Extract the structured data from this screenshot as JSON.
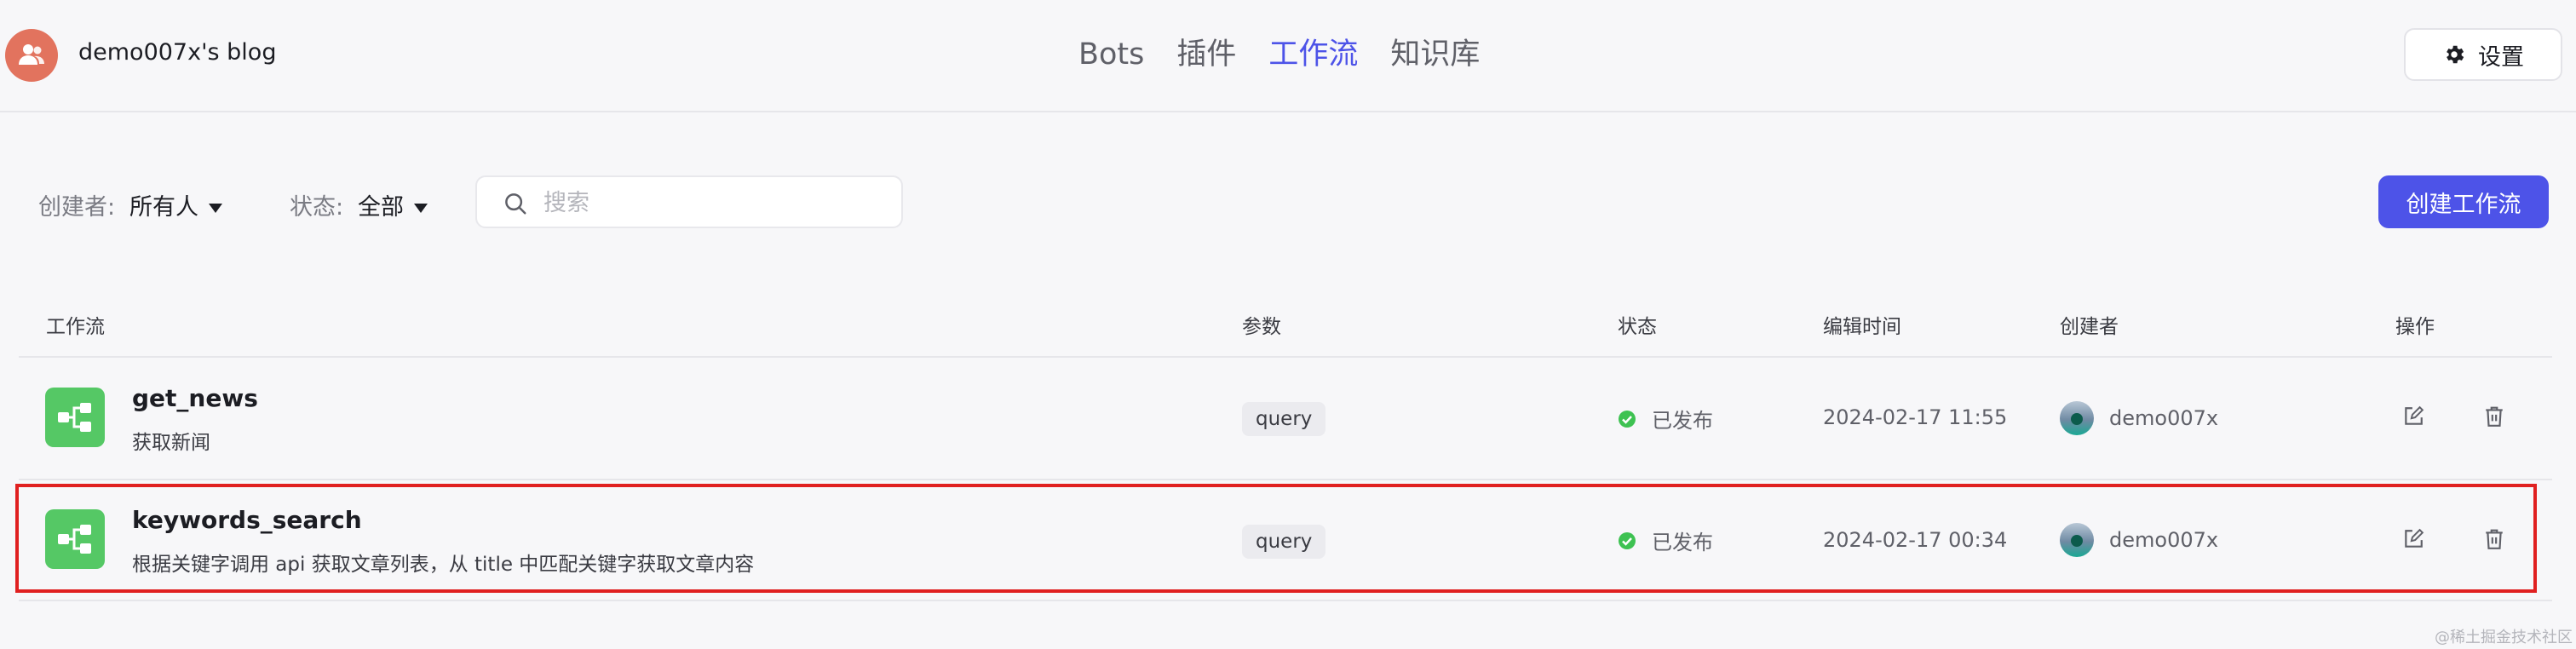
{
  "header": {
    "blog_title": "demo007x's blog",
    "nav": [
      {
        "label": "Bots",
        "active": false
      },
      {
        "label": "插件",
        "active": false
      },
      {
        "label": "工作流",
        "active": true
      },
      {
        "label": "知识库",
        "active": false
      }
    ],
    "settings_label": "设置"
  },
  "filters": {
    "creator_label": "创建者:",
    "creator_value": "所有人",
    "status_label": "状态:",
    "status_value": "全部",
    "search_placeholder": "搜索",
    "search_value": ""
  },
  "create_button_label": "创建工作流",
  "table": {
    "headers": {
      "workflow": "工作流",
      "params": "参数",
      "status": "状态",
      "edit_time": "编辑时间",
      "creator": "创建者",
      "actions": "操作"
    },
    "rows": [
      {
        "name": "get_news",
        "description": "获取新闻",
        "param": "query",
        "status": "已发布",
        "edit_time": "2024-02-17 11:55",
        "creator": "demo007x",
        "selected": false
      },
      {
        "name": "keywords_search",
        "description": "根据关键字调用 api 获取文章列表，从 title 中匹配关键字获取文章内容",
        "param": "query",
        "status": "已发布",
        "edit_time": "2024-02-17 00:34",
        "creator": "demo007x",
        "selected": true
      }
    ]
  },
  "colors": {
    "accent": "#4d53e8",
    "workflow_icon": "#55c865",
    "published": "#3ec252",
    "highlight_border": "#e02020",
    "avatar": "#e2735e"
  },
  "watermark": "@稀土掘金技术社区"
}
